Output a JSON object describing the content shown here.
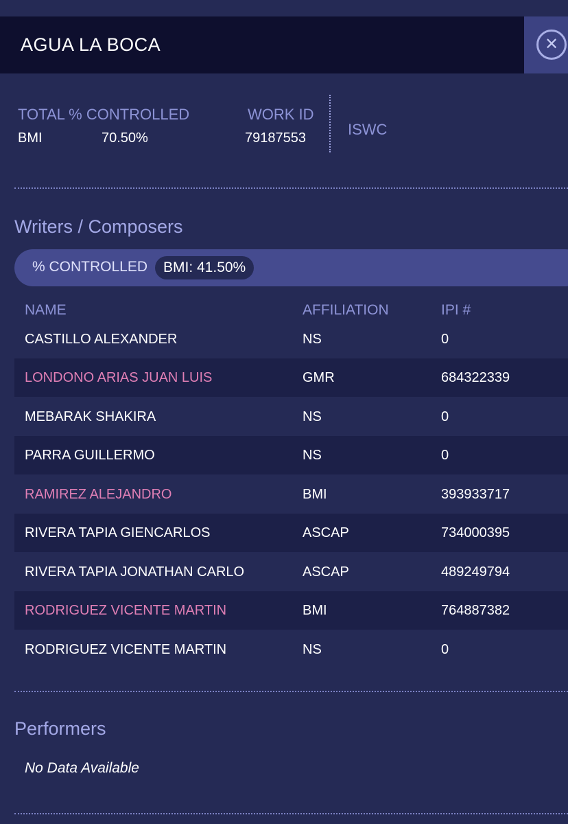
{
  "header": {
    "title": "AGUA LA BOCA"
  },
  "summary": {
    "total_controlled_label": "TOTAL % CONTROLLED",
    "society": "BMI",
    "percent": "70.50%",
    "work_id_label": "WORK ID",
    "work_id": "79187553",
    "iswc_label": "ISWC"
  },
  "writers": {
    "title": "Writers / Composers",
    "controlled_label": "% CONTROLLED",
    "controlled_badge": "BMI: 41.50%",
    "columns": {
      "name": "NAME",
      "affiliation": "AFFILIATION",
      "ipi": "IPI #"
    },
    "rows": [
      {
        "name": "CASTILLO ALEXANDER",
        "affiliation": "NS",
        "ipi": "0",
        "highlight": false
      },
      {
        "name": "LONDONO ARIAS JUAN LUIS",
        "affiliation": "GMR",
        "ipi": "684322339",
        "highlight": true
      },
      {
        "name": "MEBARAK SHAKIRA",
        "affiliation": "NS",
        "ipi": "0",
        "highlight": false
      },
      {
        "name": "PARRA GUILLERMO",
        "affiliation": "NS",
        "ipi": "0",
        "highlight": false
      },
      {
        "name": "RAMIREZ ALEJANDRO",
        "affiliation": "BMI",
        "ipi": "393933717",
        "highlight": true
      },
      {
        "name": "RIVERA TAPIA GIENCARLOS",
        "affiliation": "ASCAP",
        "ipi": "734000395",
        "highlight": false
      },
      {
        "name": "RIVERA TAPIA JONATHAN CARLO",
        "affiliation": "ASCAP",
        "ipi": "489249794",
        "highlight": false
      },
      {
        "name": "RODRIGUEZ VICENTE MARTIN",
        "affiliation": "BMI",
        "ipi": "764887382",
        "highlight": true
      },
      {
        "name": "RODRIGUEZ VICENTE MARTIN",
        "affiliation": "NS",
        "ipi": "0",
        "highlight": false
      }
    ]
  },
  "performers": {
    "title": "Performers",
    "empty_text": "No Data Available"
  },
  "colors": {
    "background": "#252a55",
    "header_bg": "#0e0f2e",
    "accent_pink": "#e07fb5",
    "muted_label": "#8d93d6"
  },
  "icons": {
    "close": "close-icon"
  }
}
